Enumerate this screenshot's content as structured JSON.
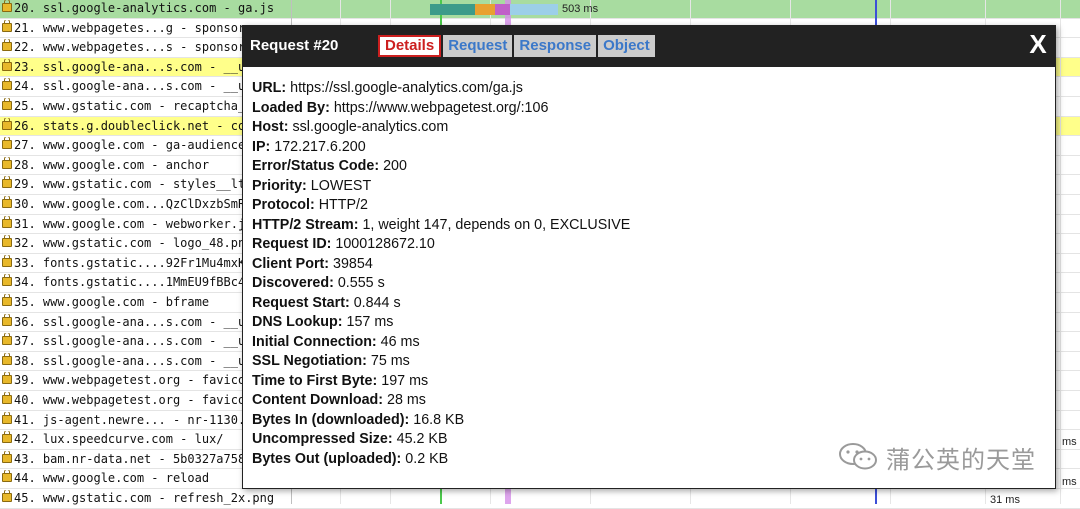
{
  "waterfall": {
    "rows": [
      {
        "label": "20. ssl.google-analytics.com - ga.js",
        "hl": "green"
      },
      {
        "label": "21. www.webpagetes...g - sponsor",
        "hl": ""
      },
      {
        "label": "22. www.webpagetes...s - sponsors",
        "hl": ""
      },
      {
        "label": "23. ssl.google-ana...s.com - __u",
        "hl": "yellow"
      },
      {
        "label": "24. ssl.google-ana...s.com - __u",
        "hl": ""
      },
      {
        "label": "25. www.gstatic.com - recaptcha_",
        "hl": ""
      },
      {
        "label": "26. stats.g.doubleclick.net - co",
        "hl": "yellow"
      },
      {
        "label": "27. www.google.com - ga-audience",
        "hl": ""
      },
      {
        "label": "28. www.google.com - anchor",
        "hl": ""
      },
      {
        "label": "29. www.gstatic.com - styles__lt",
        "hl": ""
      },
      {
        "label": "30. www.google.com...QzClDxzbSmR",
        "hl": ""
      },
      {
        "label": "31. www.google.com - webworker.j",
        "hl": ""
      },
      {
        "label": "32. www.gstatic.com - logo_48.pn",
        "hl": ""
      },
      {
        "label": "33. fonts.gstatic....92Fr1Mu4mxK",
        "hl": ""
      },
      {
        "label": "34. fonts.gstatic....1MmEU9fBBc4",
        "hl": ""
      },
      {
        "label": "35. www.google.com - bframe",
        "hl": ""
      },
      {
        "label": "36. ssl.google-ana...s.com - __u",
        "hl": ""
      },
      {
        "label": "37. ssl.google-ana...s.com - __u",
        "hl": ""
      },
      {
        "label": "38. ssl.google-ana...s.com - __u",
        "hl": ""
      },
      {
        "label": "39. www.webpagetest.org - favico",
        "hl": ""
      },
      {
        "label": "40. www.webpagetest.org - favico",
        "hl": ""
      },
      {
        "label": "41. js-agent.newre... - nr-1130.",
        "hl": ""
      },
      {
        "label": "42. lux.speedcurve.com - lux/",
        "hl": ""
      },
      {
        "label": "43. bam.nr-data.net - 5b0327a758",
        "hl": ""
      },
      {
        "label": "44. www.google.com - reload",
        "hl": ""
      },
      {
        "label": "45. www.gstatic.com - refresh_2x.png",
        "hl": ""
      }
    ],
    "timing_labels": [
      "503 ms",
      "ms",
      "ms",
      "31 ms"
    ]
  },
  "dialog": {
    "title": "Request #20",
    "tabs": [
      "Details",
      "Request",
      "Response",
      "Object"
    ],
    "close_label": "X",
    "details": [
      {
        "label": "URL:",
        "value": " https://ssl.google-analytics.com/ga.js"
      },
      {
        "label": "Loaded By:",
        "value": " https://www.webpagetest.org/:106"
      },
      {
        "label": "Host:",
        "value": " ssl.google-analytics.com"
      },
      {
        "label": "IP:",
        "value": " 172.217.6.200"
      },
      {
        "label": "Error/Status Code:",
        "value": " 200"
      },
      {
        "label": "Priority:",
        "value": " LOWEST"
      },
      {
        "label": "Protocol:",
        "value": " HTTP/2"
      },
      {
        "label": "HTTP/2 Stream:",
        "value": " 1, weight 147, depends on 0, EXCLUSIVE"
      },
      {
        "label": "Request ID:",
        "value": " 1000128672.10"
      },
      {
        "label": "Client Port:",
        "value": " 39854"
      },
      {
        "label": "Discovered:",
        "value": " 0.555 s"
      },
      {
        "label": "Request Start:",
        "value": " 0.844 s"
      },
      {
        "label": "DNS Lookup:",
        "value": " 157 ms"
      },
      {
        "label": "Initial Connection:",
        "value": " 46 ms"
      },
      {
        "label": "SSL Negotiation:",
        "value": " 75 ms"
      },
      {
        "label": "Time to First Byte:",
        "value": " 197 ms"
      },
      {
        "label": "Content Download:",
        "value": " 28 ms"
      },
      {
        "label": "Bytes In (downloaded):",
        "value": " 16.8 KB"
      },
      {
        "label": "Uncompressed Size:",
        "value": " 45.2 KB"
      },
      {
        "label": "Bytes Out (uploaded):",
        "value": " 0.2 KB"
      }
    ]
  },
  "watermark": {
    "text": "蒲公英的天堂",
    "icon": "wechat-icon"
  },
  "colors": {
    "dialog_header": "#222222",
    "tab_active": "#cc1f1f",
    "tab_inactive_text": "#3b78c9",
    "row_highlight_yellow": "#ffff8a",
    "row_highlight_green": "#a8dca0"
  }
}
